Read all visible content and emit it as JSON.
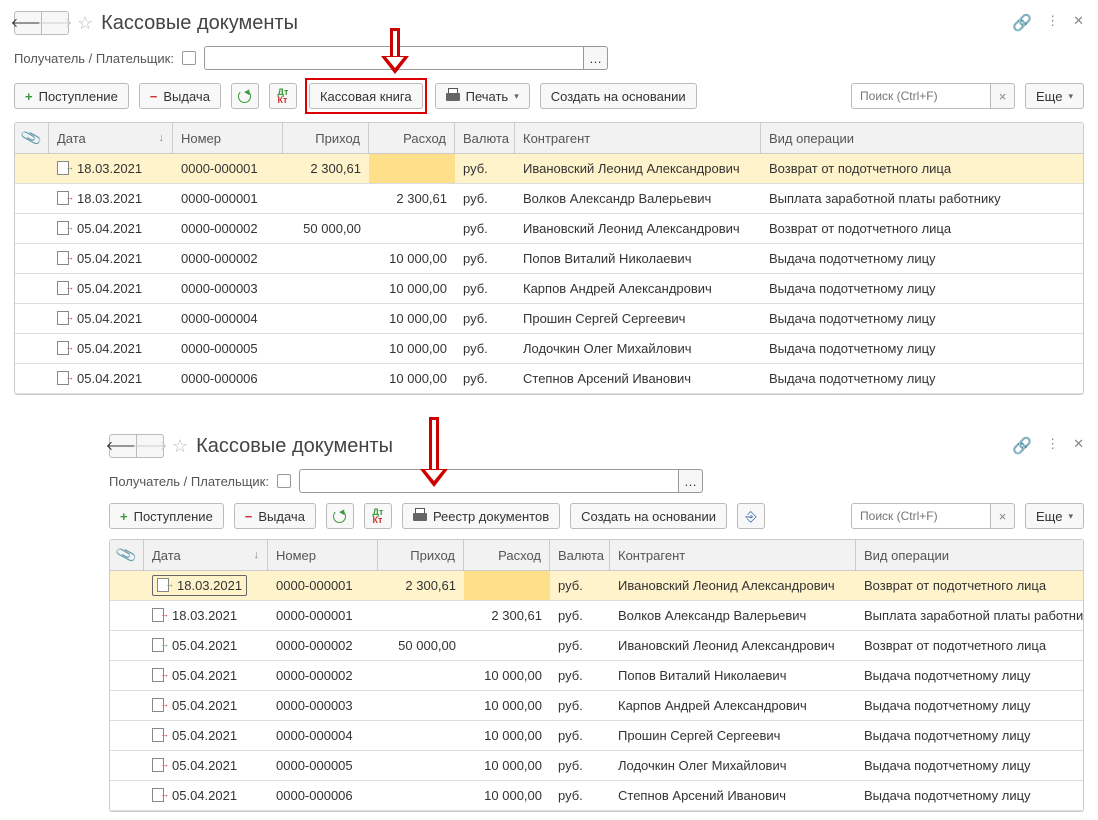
{
  "view1": {
    "title": "Кассовые документы",
    "filterLabel": "Получатель / Плательщик:",
    "toolbar": {
      "receipt": "Поступление",
      "payout": "Выдача",
      "cashbook": "Кассовая книга",
      "print": "Печать",
      "createBasedOn": "Создать на основании",
      "searchPlaceholder": "Поиск (Ctrl+F)",
      "more": "Еще"
    },
    "columns": {
      "date": "Дата",
      "number": "Номер",
      "income": "Приход",
      "expense": "Расход",
      "currency": "Валюта",
      "counterparty": "Контрагент",
      "operation": "Вид операции"
    },
    "rows": [
      {
        "dir": "in",
        "date": "18.03.2021",
        "num": "0000-000001",
        "inc": "2 300,61",
        "exp": "",
        "cur": "руб.",
        "cp": "Ивановский Леонид Александрович",
        "op": "Возврат от подотчетного лица",
        "sel": true
      },
      {
        "dir": "out",
        "date": "18.03.2021",
        "num": "0000-000001",
        "inc": "",
        "exp": "2 300,61",
        "cur": "руб.",
        "cp": "Волков Александр Валерьевич",
        "op": "Выплата заработной платы работнику"
      },
      {
        "dir": "in",
        "date": "05.04.2021",
        "num": "0000-000002",
        "inc": "50 000,00",
        "exp": "",
        "cur": "руб.",
        "cp": "Ивановский Леонид Александрович",
        "op": "Возврат от подотчетного лица"
      },
      {
        "dir": "out",
        "date": "05.04.2021",
        "num": "0000-000002",
        "inc": "",
        "exp": "10 000,00",
        "cur": "руб.",
        "cp": "Попов Виталий Николаевич",
        "op": "Выдача подотчетному лицу"
      },
      {
        "dir": "out",
        "date": "05.04.2021",
        "num": "0000-000003",
        "inc": "",
        "exp": "10 000,00",
        "cur": "руб.",
        "cp": "Карпов Андрей Александрович",
        "op": "Выдача подотчетному лицу"
      },
      {
        "dir": "out",
        "date": "05.04.2021",
        "num": "0000-000004",
        "inc": "",
        "exp": "10 000,00",
        "cur": "руб.",
        "cp": "Прошин Сергей Сергеевич",
        "op": "Выдача подотчетному лицу"
      },
      {
        "dir": "out",
        "date": "05.04.2021",
        "num": "0000-000005",
        "inc": "",
        "exp": "10 000,00",
        "cur": "руб.",
        "cp": "Лодочкин Олег Михайлович",
        "op": "Выдача подотчетному лицу"
      },
      {
        "dir": "out",
        "date": "05.04.2021",
        "num": "0000-000006",
        "inc": "",
        "exp": "10 000,00",
        "cur": "руб.",
        "cp": "Степнов Арсений Иванович",
        "op": "Выдача подотчетному лицу"
      }
    ]
  },
  "view2": {
    "title": "Кассовые документы",
    "filterLabel": "Получатель / Плательщик:",
    "toolbar": {
      "receipt": "Поступление",
      "payout": "Выдача",
      "registry": "Реестр документов",
      "createBasedOn": "Создать на основании",
      "searchPlaceholder": "Поиск (Ctrl+F)",
      "more": "Еще"
    },
    "columns": {
      "date": "Дата",
      "number": "Номер",
      "income": "Приход",
      "expense": "Расход",
      "currency": "Валюта",
      "counterparty": "Контрагент",
      "operation": "Вид операции"
    },
    "rows": [
      {
        "dir": "in",
        "date": "18.03.2021",
        "num": "0000-000001",
        "inc": "2 300,61",
        "exp": "",
        "cur": "руб.",
        "cp": "Ивановский Леонид Александрович",
        "op": "Возврат от подотчетного лица",
        "sel": true,
        "focus": true
      },
      {
        "dir": "out",
        "date": "18.03.2021",
        "num": "0000-000001",
        "inc": "",
        "exp": "2 300,61",
        "cur": "руб.",
        "cp": "Волков Александр Валерьевич",
        "op": "Выплата заработной платы работнику"
      },
      {
        "dir": "in",
        "date": "05.04.2021",
        "num": "0000-000002",
        "inc": "50 000,00",
        "exp": "",
        "cur": "руб.",
        "cp": "Ивановский Леонид Александрович",
        "op": "Возврат от подотчетного лица"
      },
      {
        "dir": "out",
        "date": "05.04.2021",
        "num": "0000-000002",
        "inc": "",
        "exp": "10 000,00",
        "cur": "руб.",
        "cp": "Попов Виталий Николаевич",
        "op": "Выдача подотчетному лицу"
      },
      {
        "dir": "out",
        "date": "05.04.2021",
        "num": "0000-000003",
        "inc": "",
        "exp": "10 000,00",
        "cur": "руб.",
        "cp": "Карпов Андрей Александрович",
        "op": "Выдача подотчетному лицу"
      },
      {
        "dir": "out",
        "date": "05.04.2021",
        "num": "0000-000004",
        "inc": "",
        "exp": "10 000,00",
        "cur": "руб.",
        "cp": "Прошин Сергей Сергеевич",
        "op": "Выдача подотчетному лицу"
      },
      {
        "dir": "out",
        "date": "05.04.2021",
        "num": "0000-000005",
        "inc": "",
        "exp": "10 000,00",
        "cur": "руб.",
        "cp": "Лодочкин Олег Михайлович",
        "op": "Выдача подотчетному лицу"
      },
      {
        "dir": "out",
        "date": "05.04.2021",
        "num": "0000-000006",
        "inc": "",
        "exp": "10 000,00",
        "cur": "руб.",
        "cp": "Степнов Арсений Иванович",
        "op": "Выдача подотчетному лицу"
      }
    ]
  }
}
